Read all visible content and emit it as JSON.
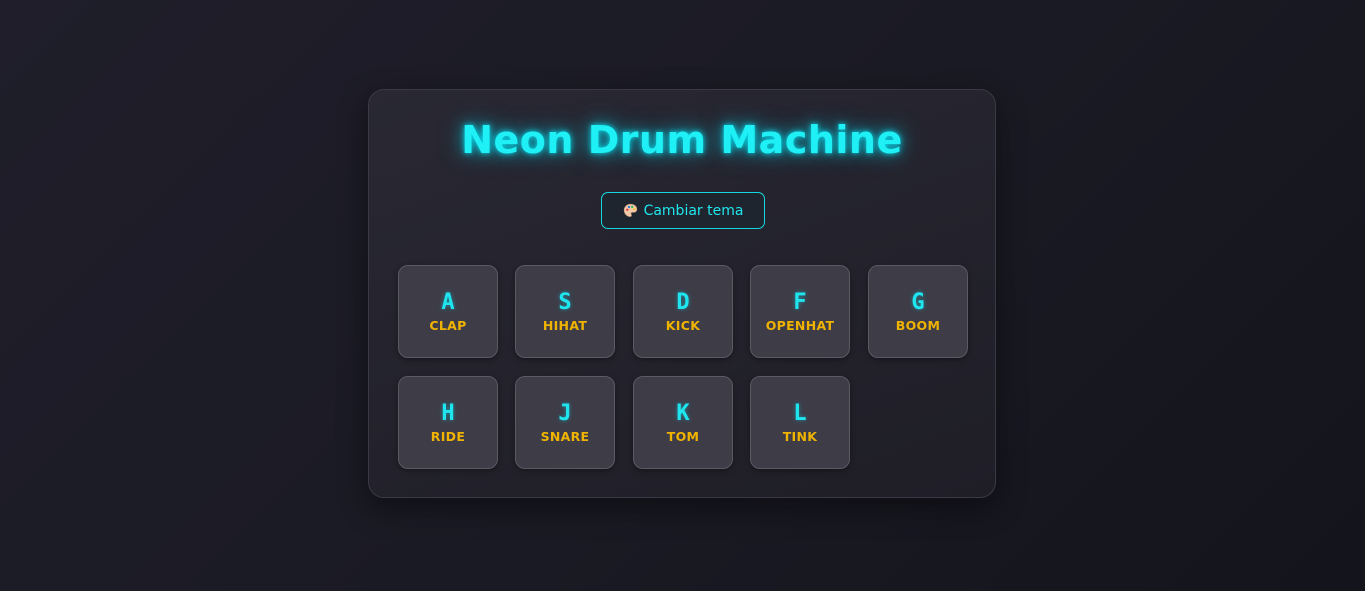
{
  "app": {
    "title": "Neon Drum Machine"
  },
  "theme_button": {
    "icon": "palette-icon",
    "label": "Cambiar tema"
  },
  "pads": [
    {
      "key": "A",
      "sound": "clap"
    },
    {
      "key": "S",
      "sound": "hihat"
    },
    {
      "key": "D",
      "sound": "kick"
    },
    {
      "key": "F",
      "sound": "openhat"
    },
    {
      "key": "G",
      "sound": "boom"
    },
    {
      "key": "H",
      "sound": "ride"
    },
    {
      "key": "J",
      "sound": "snare"
    },
    {
      "key": "K",
      "sound": "tom"
    },
    {
      "key": "L",
      "sound": "tink"
    }
  ],
  "colors": {
    "accent": "#1ff0f5",
    "sound_label": "#f0b400",
    "pad_background": "#3d3c47",
    "panel_background": "#26252f",
    "page_background": "#1a1a24"
  }
}
